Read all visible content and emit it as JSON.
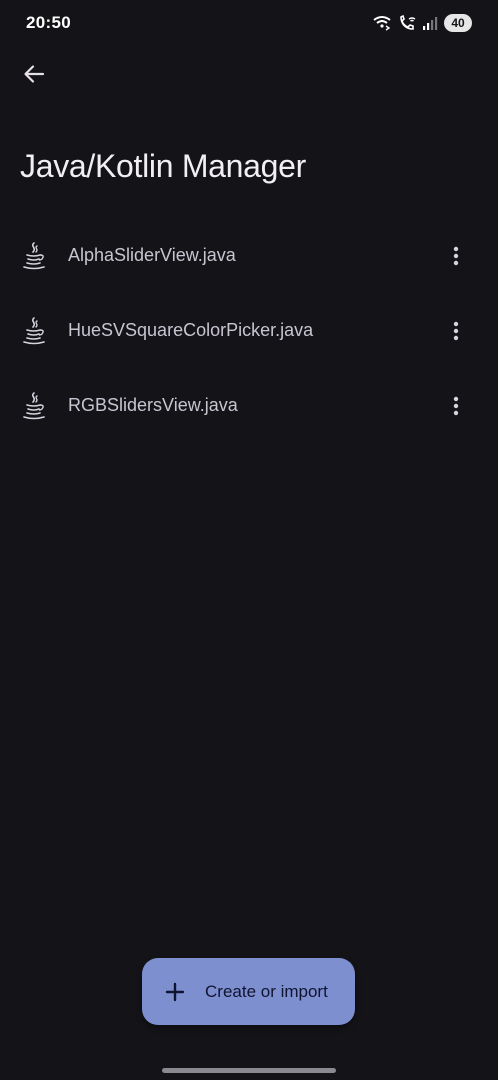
{
  "status_bar": {
    "time": "20:50",
    "battery_level": "40",
    "icons": [
      "wifi-calling-icon",
      "call-wifi-icon",
      "signal-icon",
      "battery-icon"
    ]
  },
  "app_bar": {
    "back_icon": "arrow-back-icon",
    "title": "Java/Kotlin Manager"
  },
  "files": [
    {
      "name": "AlphaSliderView.java",
      "icon": "java-icon",
      "menu_icon": "more-vert-icon"
    },
    {
      "name": "HueSVSquareColorPicker.java",
      "icon": "java-icon",
      "menu_icon": "more-vert-icon"
    },
    {
      "name": "RGBSlidersView.java",
      "icon": "java-icon",
      "menu_icon": "more-vert-icon"
    }
  ],
  "fab": {
    "icon": "add-icon",
    "label": "Create or import",
    "color": "#7e8fd0"
  },
  "theme": {
    "background": "#131318",
    "text_primary": "#f1eef4",
    "text_secondary": "#c9c5d0"
  }
}
